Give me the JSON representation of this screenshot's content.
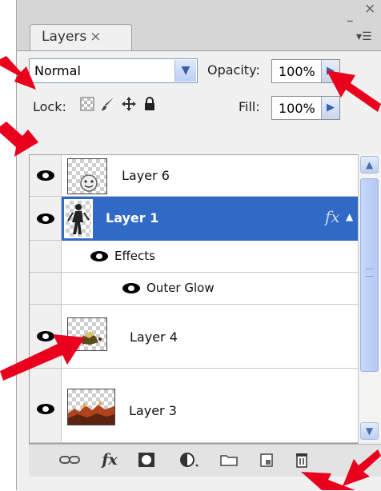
{
  "panel": {
    "tab_label": "Layers",
    "tab_close": "×",
    "window_min": "–",
    "window_close": "×",
    "menu_glyph": "▾☰"
  },
  "blend_mode": {
    "value": "Normal"
  },
  "opacity": {
    "label": "Opacity:",
    "value": "100%"
  },
  "lock": {
    "label": "Lock:"
  },
  "fill": {
    "label": "Fill:",
    "value": "100%"
  },
  "layers": [
    {
      "name": "Layer 6",
      "visible": true,
      "selected": false
    },
    {
      "name": "Layer 1",
      "visible": true,
      "selected": true,
      "has_fx": true,
      "fx_glyph": "fx"
    },
    {
      "name": "Effects",
      "visible": true
    },
    {
      "name": "Outer Glow",
      "visible": true
    },
    {
      "name": "Layer 4",
      "visible": true,
      "selected": false
    },
    {
      "name": "Layer 3",
      "visible": true,
      "selected": false
    }
  ],
  "bottom_bar": {
    "icons": [
      "link-layers-icon",
      "add-layer-style-icon",
      "add-mask-icon",
      "adjustment-layer-icon",
      "new-group-icon",
      "new-layer-icon",
      "delete-layer-icon"
    ],
    "fx_glyph": "fx"
  },
  "colors": {
    "selection": "#3169c6",
    "annotation_arrow": "#e8001c"
  }
}
